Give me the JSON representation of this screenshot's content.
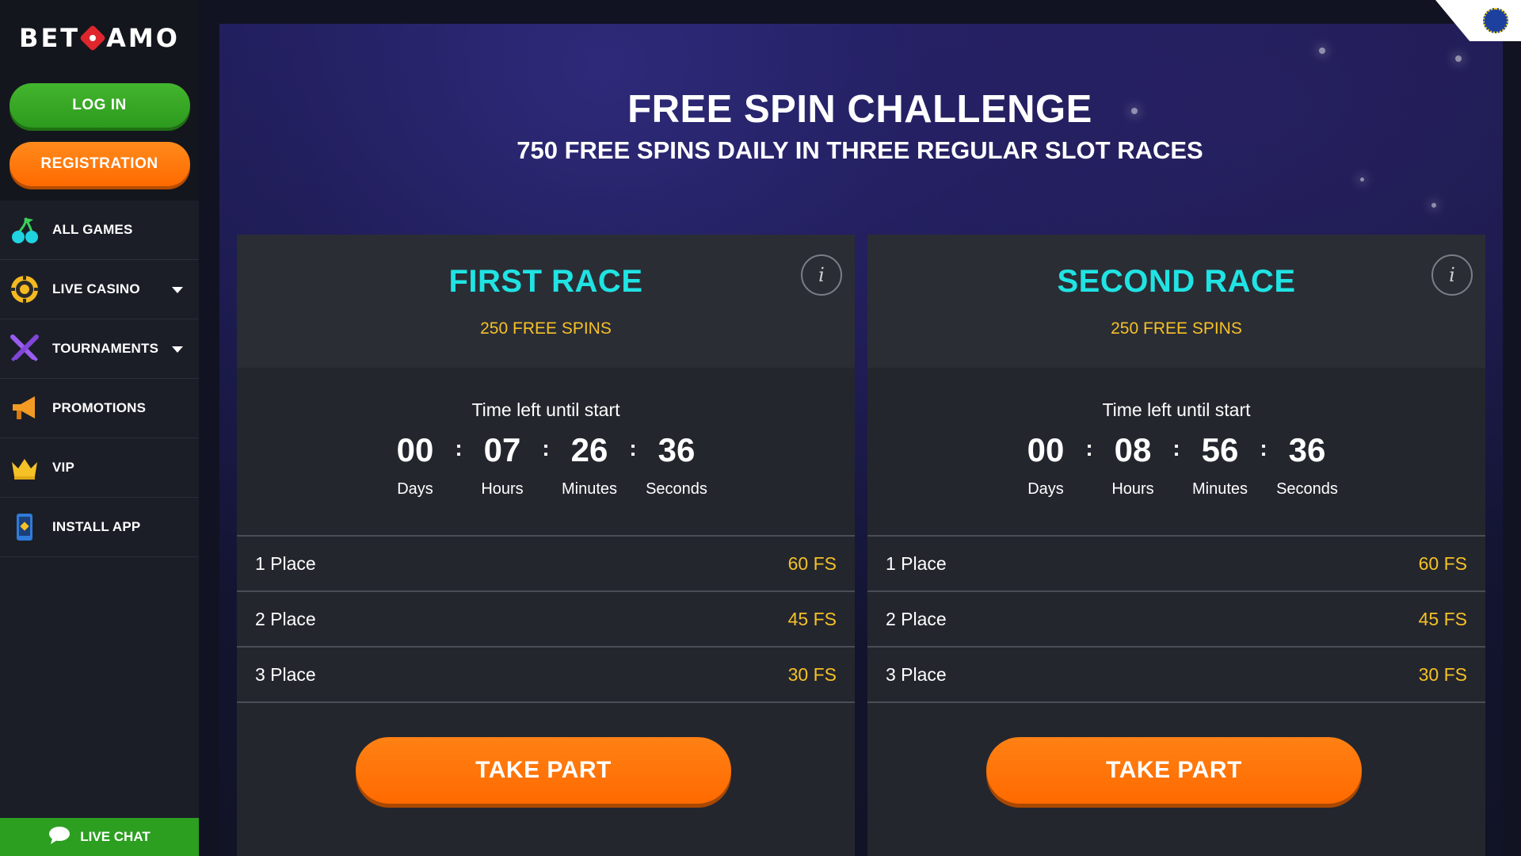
{
  "sidebar": {
    "logo_left": "BET",
    "logo_right": "AMO",
    "login_label": "LOG IN",
    "registration_label": "REGISTRATION",
    "items": [
      {
        "label": "ALL GAMES",
        "icon": "cherries-icon"
      },
      {
        "label": "LIVE CASINO",
        "icon": "casino-chip-icon",
        "has_dropdown": true
      },
      {
        "label": "TOURNAMENTS",
        "icon": "crossed-swords-icon",
        "has_dropdown": true
      },
      {
        "label": "PROMOTIONS",
        "icon": "megaphone-icon"
      },
      {
        "label": "VIP",
        "icon": "crown-icon"
      },
      {
        "label": "INSTALL APP",
        "icon": "phone-app-icon"
      }
    ],
    "live_chat_label": "LIVE CHAT"
  },
  "header": {
    "title": "FREE SPIN CHALLENGE",
    "subtitle": "750 FREE SPINS DAILY IN THREE REGULAR SLOT RACES",
    "language_icon": "eu-flag-icon"
  },
  "races": [
    {
      "title": "FIRST RACE",
      "prize": "250 FREE SPINS",
      "timer_label": "Time left until start",
      "countdown": {
        "days": "00",
        "hours": "07",
        "minutes": "26",
        "seconds": "36"
      },
      "captions": {
        "days": "Days",
        "hours": "Hours",
        "minutes": "Minutes",
        "seconds": "Seconds"
      },
      "places": [
        {
          "place": "1 Place",
          "prize": "60 FS"
        },
        {
          "place": "2 Place",
          "prize": "45 FS"
        },
        {
          "place": "3 Place",
          "prize": "30 FS"
        }
      ],
      "button_label": "TAKE PART"
    },
    {
      "title": "SECOND RACE",
      "prize": "250 FREE SPINS",
      "timer_label": "Time left until start",
      "countdown": {
        "days": "00",
        "hours": "08",
        "minutes": "56",
        "seconds": "36"
      },
      "captions": {
        "days": "Days",
        "hours": "Hours",
        "minutes": "Minutes",
        "seconds": "Seconds"
      },
      "places": [
        {
          "place": "1 Place",
          "prize": "60 FS"
        },
        {
          "place": "2 Place",
          "prize": "45 FS"
        },
        {
          "place": "3 Place",
          "prize": "30 FS"
        }
      ],
      "button_label": "TAKE PART"
    }
  ],
  "colors": {
    "accent_cyan": "#20e3e3",
    "prize_gold": "#f5c126",
    "cta_orange": "#ff6a00",
    "login_green": "#2d9a1e"
  }
}
